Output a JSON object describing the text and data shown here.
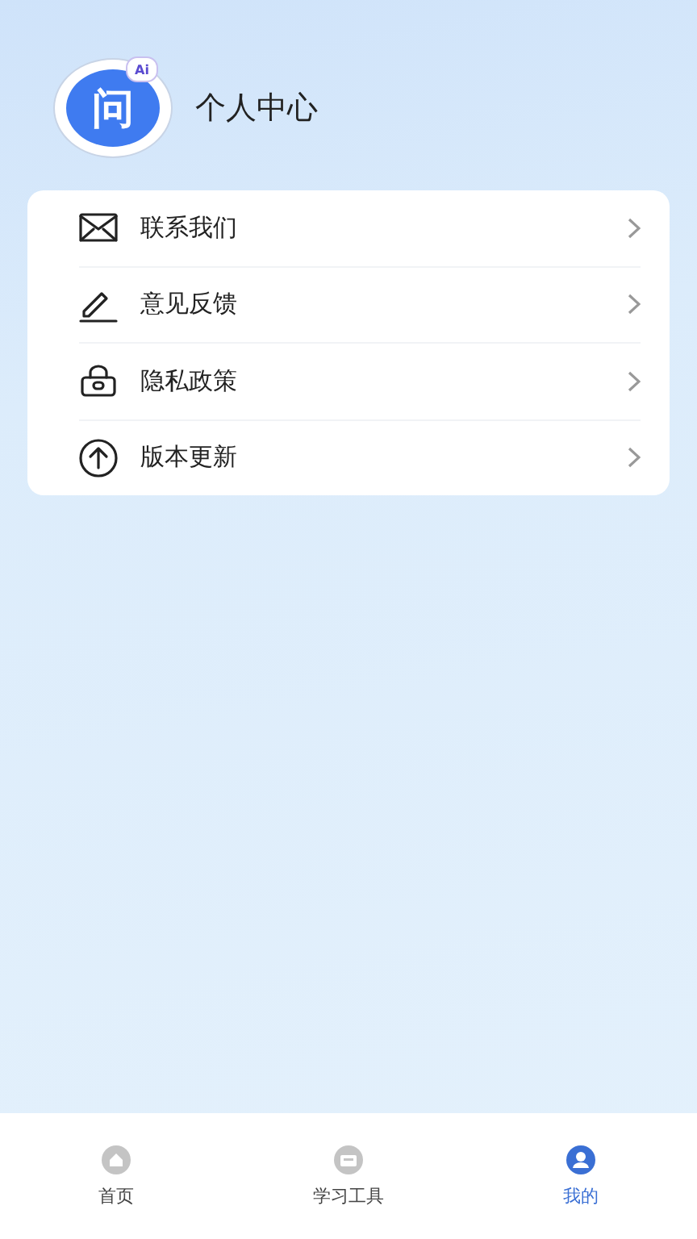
{
  "header": {
    "logo_text": "问",
    "logo_badge": "Ai",
    "title": "个人中心"
  },
  "menu": [
    {
      "kind": "mail",
      "label": "联系我们"
    },
    {
      "kind": "edit",
      "label": "意见反馈"
    },
    {
      "kind": "lock",
      "label": "隐私政策"
    },
    {
      "kind": "upload",
      "label": "版本更新"
    }
  ],
  "tabs": [
    {
      "kind": "home",
      "label": "首页",
      "selected": false
    },
    {
      "kind": "tools",
      "label": "学习工具",
      "selected": false
    },
    {
      "kind": "user",
      "label": "我的",
      "selected": true
    }
  ]
}
